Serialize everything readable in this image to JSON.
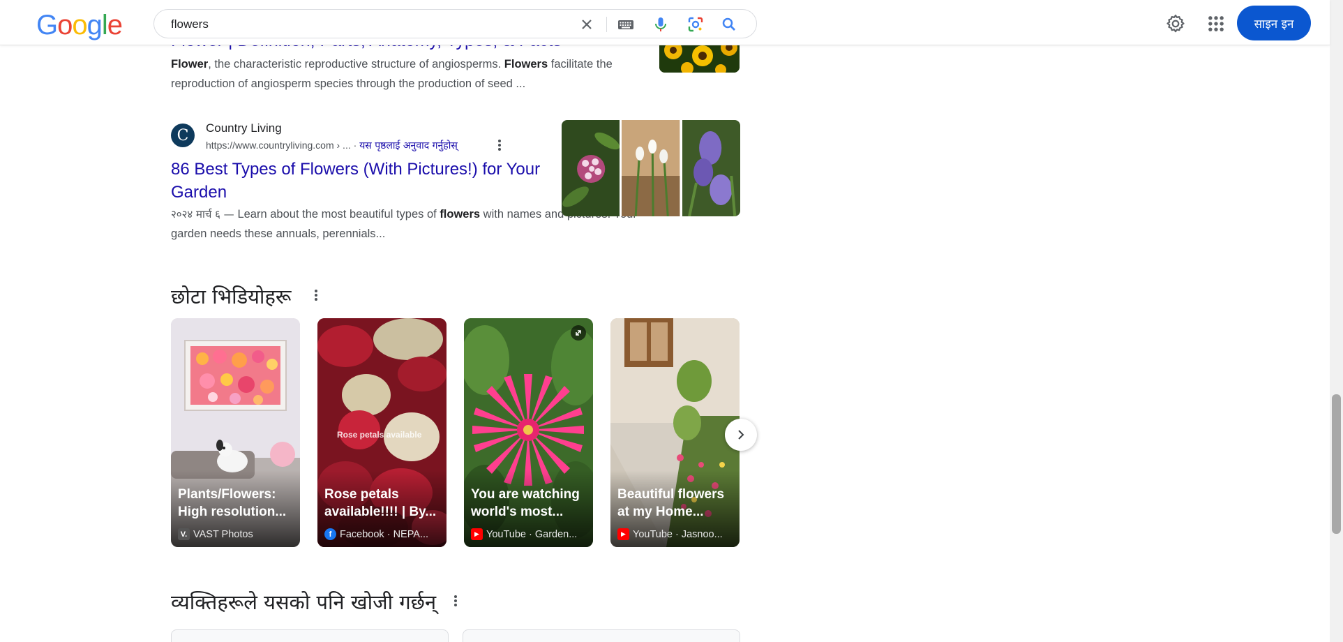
{
  "header": {
    "logo": [
      "G",
      "o",
      "o",
      "g",
      "l",
      "e"
    ],
    "logo_colors": [
      "#4285f4",
      "#ea4335",
      "#fbbc05",
      "#4285f4",
      "#34a853",
      "#ea4335"
    ],
    "search_value": "flowers",
    "signin_label": "साइन इन"
  },
  "results": [
    {
      "title": "Flower | Definition, Parts, Anatomy, Types, & Facts",
      "snippet_parts": [
        {
          "b": "Flower"
        },
        {
          "t": ", the characteristic reproductive structure of angiosperms. "
        },
        {
          "b": "Flowers"
        },
        {
          "t": " facilitate the reproduction of angiosperm species through the production of seed ..."
        }
      ]
    },
    {
      "favicon": "C",
      "site": "Country Living",
      "url": "https://www.countryliving.com › ...",
      "translate": "यस पृष्ठलाई अनुवाद गर्नुहोस्",
      "title": "86 Best Types of Flowers (With Pictures!) for Your Garden",
      "date": "२०२४ मार्च ६ — ",
      "snippet_parts": [
        {
          "t": "Learn about the most beautiful types of "
        },
        {
          "b": "flowers"
        },
        {
          "t": " with names and pictures. Your garden needs these annuals, perennials..."
        }
      ]
    }
  ],
  "short_videos": {
    "heading": "छोटा भिडियोहरू",
    "cards": [
      {
        "title1": "Plants/Flowers:",
        "title2": "High resolution...",
        "source": "VAST Photos",
        "badge": "V.",
        "badge_color": "#3c3c3c"
      },
      {
        "title1": "Rose petals",
        "title2": "available!!!! | By...",
        "source": "Facebook · NEPA...",
        "badge": "f",
        "badge_color": "#1877f2",
        "overlay": "Rose petals available"
      },
      {
        "title1": "You are watching",
        "title2": "world's most...",
        "source": "YouTube · Garden...",
        "badge": "▶",
        "badge_color": "#ff0000"
      },
      {
        "title1": "Beautiful flowers",
        "title2": "at my Home...",
        "source": "YouTube · Jasnoo...",
        "badge": "▶",
        "badge_color": "#ff0000"
      }
    ]
  },
  "people_also_search": {
    "heading": "व्यक्तिहरूले यसको पनि खोजी गर्छन्"
  }
}
